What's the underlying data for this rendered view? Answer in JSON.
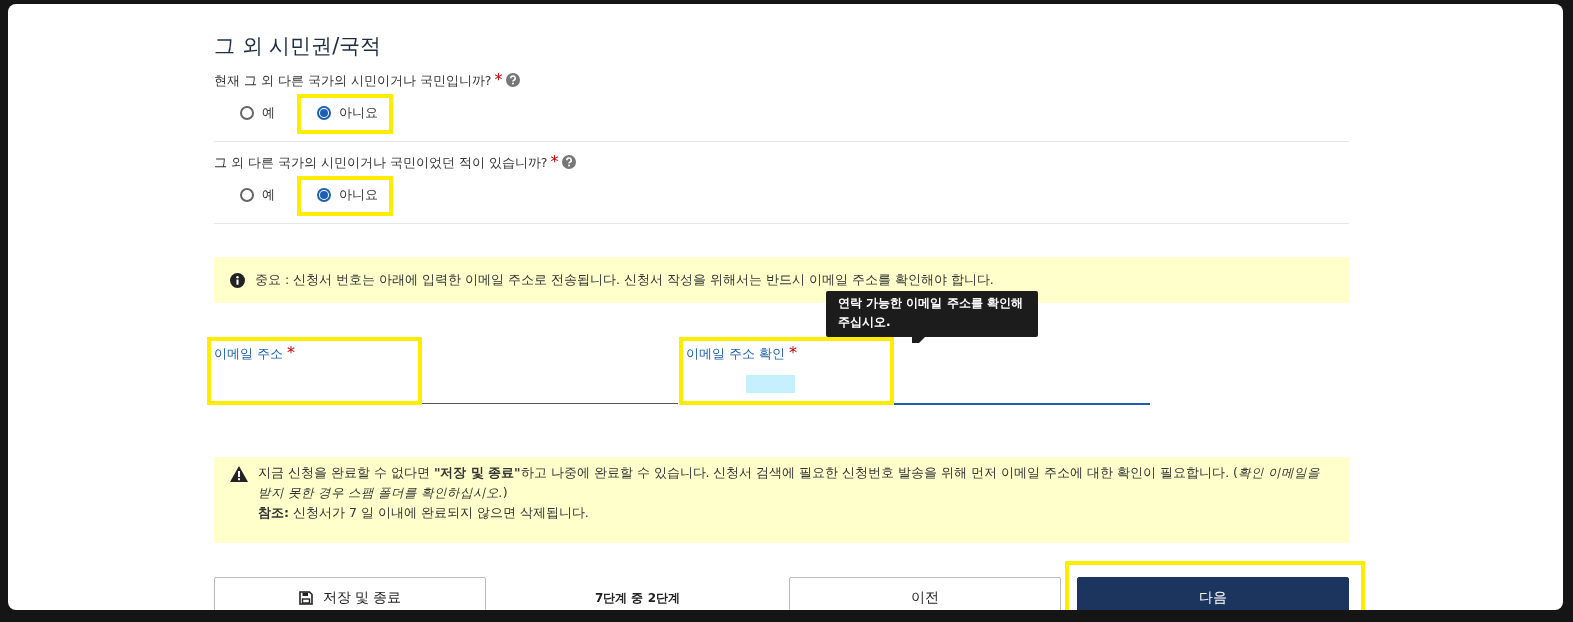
{
  "section_title": "그 외 시민권/국적",
  "questions": [
    {
      "label": "현재 그 외 다른 국가의 시민이거나 국민입니까?",
      "required_mark": "*",
      "options": [
        {
          "label": "예",
          "selected": false,
          "highlighted": false
        },
        {
          "label": "아니요",
          "selected": true,
          "highlighted": true
        }
      ]
    },
    {
      "label": "그 외 다른 국가의 시민이거나 국민이었던 적이 있습니까?",
      "required_mark": "*",
      "options": [
        {
          "label": "예",
          "selected": false,
          "highlighted": false
        },
        {
          "label": "아니요",
          "selected": true,
          "highlighted": true
        }
      ]
    }
  ],
  "info_notice": {
    "kind": "info",
    "text": "중요 : 신청서 번호는 아래에 입력한 이메일 주소로 전송됩니다. 신청서 작성을 위해서는 반드시 이메일 주소를 확인해야 합니다."
  },
  "fields": [
    {
      "label": "이메일 주소",
      "required_mark": "*",
      "focused": false,
      "highlighted": true
    },
    {
      "label": "이메일 주소 확인",
      "required_mark": "*",
      "focused": true,
      "highlighted": true,
      "text_selected": true,
      "tooltip": "연락 가능한 이메일 주소를 확인해 주십시오."
    }
  ],
  "warning_notice": {
    "kind": "warning",
    "paragraphs": [
      "지금 신청을 완료할 수 없다면 **\"저장 및 종료\"**하고 나중에 완료할 수 있습니다. 신청서 검색에 필요한 신청번호 발송을 위해 먼저 이메일 주소에 대한 확인이 필요합니다. (*확인 이메일을 받지 못한 경우 스팸 폴더를 확인하십시오.*)",
      "**참조:** 신청서가 7 일 이내에 완료되지 않으면 삭제됩니다."
    ]
  },
  "footer": {
    "save_button": {
      "label": "저장 및 종료"
    },
    "step": "7단계 중 2단계",
    "previous_button": {
      "label": "이전"
    },
    "next_button": {
      "label": "다음",
      "highlighted": true
    }
  }
}
